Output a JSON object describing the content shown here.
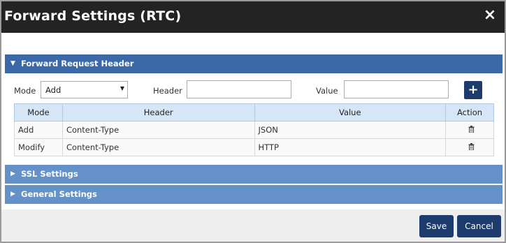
{
  "dialog": {
    "title": "Forward Settings (RTC)",
    "close_icon": "×"
  },
  "sections": [
    {
      "label": "Forward Request Header",
      "expanded": true,
      "arrow": "▼"
    },
    {
      "label": "SSL Settings",
      "expanded": false,
      "arrow": "▶"
    },
    {
      "label": "General Settings",
      "expanded": false,
      "arrow": "▶"
    }
  ],
  "form": {
    "mode_label": "Mode",
    "mode_value": "Add",
    "header_label": "Header",
    "header_value": "",
    "value_label": "Value",
    "value_value": "",
    "add_button": "+"
  },
  "table": {
    "columns": [
      "Mode",
      "Header",
      "Value",
      "Action"
    ],
    "rows": [
      {
        "mode": "Add",
        "header": "Content-Type",
        "value": "JSON",
        "action_icon": "trash-icon"
      },
      {
        "mode": "Modify",
        "header": "Content-Type",
        "value": "HTTP",
        "action_icon": "trash-icon"
      }
    ]
  },
  "footer": {
    "save": "Save",
    "cancel": "Cancel"
  },
  "colors": {
    "section_open": "#3b68a8",
    "section_closed": "#6391c8",
    "button": "#1d3c6b",
    "add_mode": "#2e7d32",
    "modify_mode": "#2d38b8"
  }
}
